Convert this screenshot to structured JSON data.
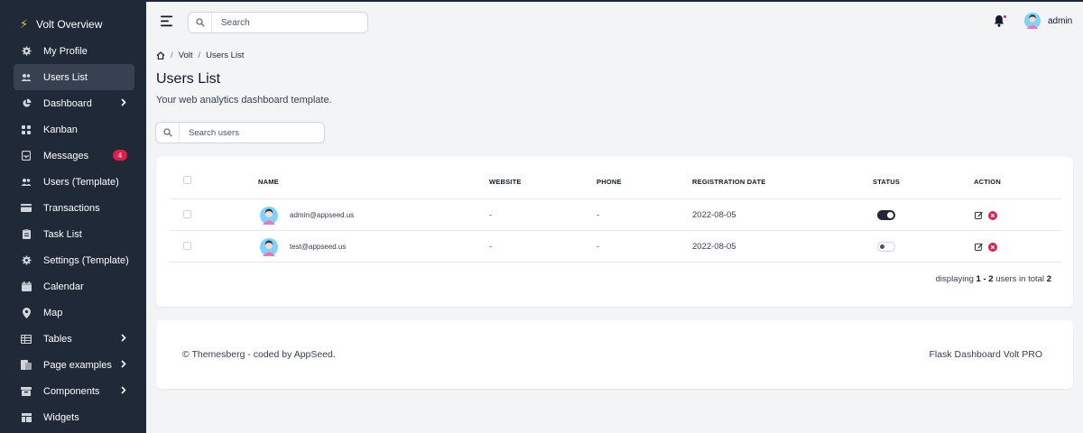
{
  "brand": "Volt Overview",
  "sidebar": {
    "items": [
      {
        "label": "My Profile",
        "icon": "gear-icon"
      },
      {
        "label": "Users List",
        "icon": "users-icon",
        "active": true
      },
      {
        "label": "Dashboard",
        "icon": "pie-chart-icon",
        "chevron": true
      },
      {
        "label": "Kanban",
        "icon": "grid-icon"
      },
      {
        "label": "Messages",
        "icon": "inbox-icon",
        "badge": "4"
      },
      {
        "label": "Users (Template)",
        "icon": "users-icon"
      },
      {
        "label": "Transactions",
        "icon": "credit-card-icon"
      },
      {
        "label": "Task List",
        "icon": "clipboard-icon"
      },
      {
        "label": "Settings (Template)",
        "icon": "gear-icon"
      },
      {
        "label": "Calendar",
        "icon": "calendar-icon"
      },
      {
        "label": "Map",
        "icon": "map-pin-icon"
      },
      {
        "label": "Tables",
        "icon": "table-icon",
        "chevron": true
      },
      {
        "label": "Page examples",
        "icon": "pages-icon",
        "chevron": true
      },
      {
        "label": "Components",
        "icon": "archive-icon",
        "chevron": true
      },
      {
        "label": "Widgets",
        "icon": "widgets-icon"
      }
    ]
  },
  "topbar": {
    "search_placeholder": "Search",
    "username": "admin"
  },
  "breadcrumb": {
    "home_icon": "home-icon",
    "level1": "Volt",
    "level2": "Users List"
  },
  "page": {
    "title": "Users List",
    "subtitle": "Your web analytics dashboard template.",
    "search_placeholder": "Search users"
  },
  "table": {
    "headers": {
      "name": "NAME",
      "website": "WEBSITE",
      "phone": "PHONE",
      "registration": "REGISTRATION DATE",
      "status": "STATUS",
      "action": "ACTION"
    },
    "rows": [
      {
        "email": "admin@appseed.us",
        "website": "-",
        "phone": "-",
        "date": "2022-08-05",
        "status": "on"
      },
      {
        "email": "test@appseed.us",
        "website": "-",
        "phone": "-",
        "date": "2022-08-05",
        "status": "off"
      }
    ],
    "pagination": {
      "prefix": "displaying",
      "range": "1 - 2",
      "middle": "users in total",
      "total": "2"
    }
  },
  "footer": {
    "left": "© Themesberg - coded by AppSeed.",
    "right": "Flask Dashboard Volt PRO"
  },
  "colors": {
    "sidebar_bg": "#1f2937",
    "active_item": "#374151",
    "badge": "#e11d48",
    "delete": "#e11d48",
    "page_bg": "#f2f4f6"
  }
}
